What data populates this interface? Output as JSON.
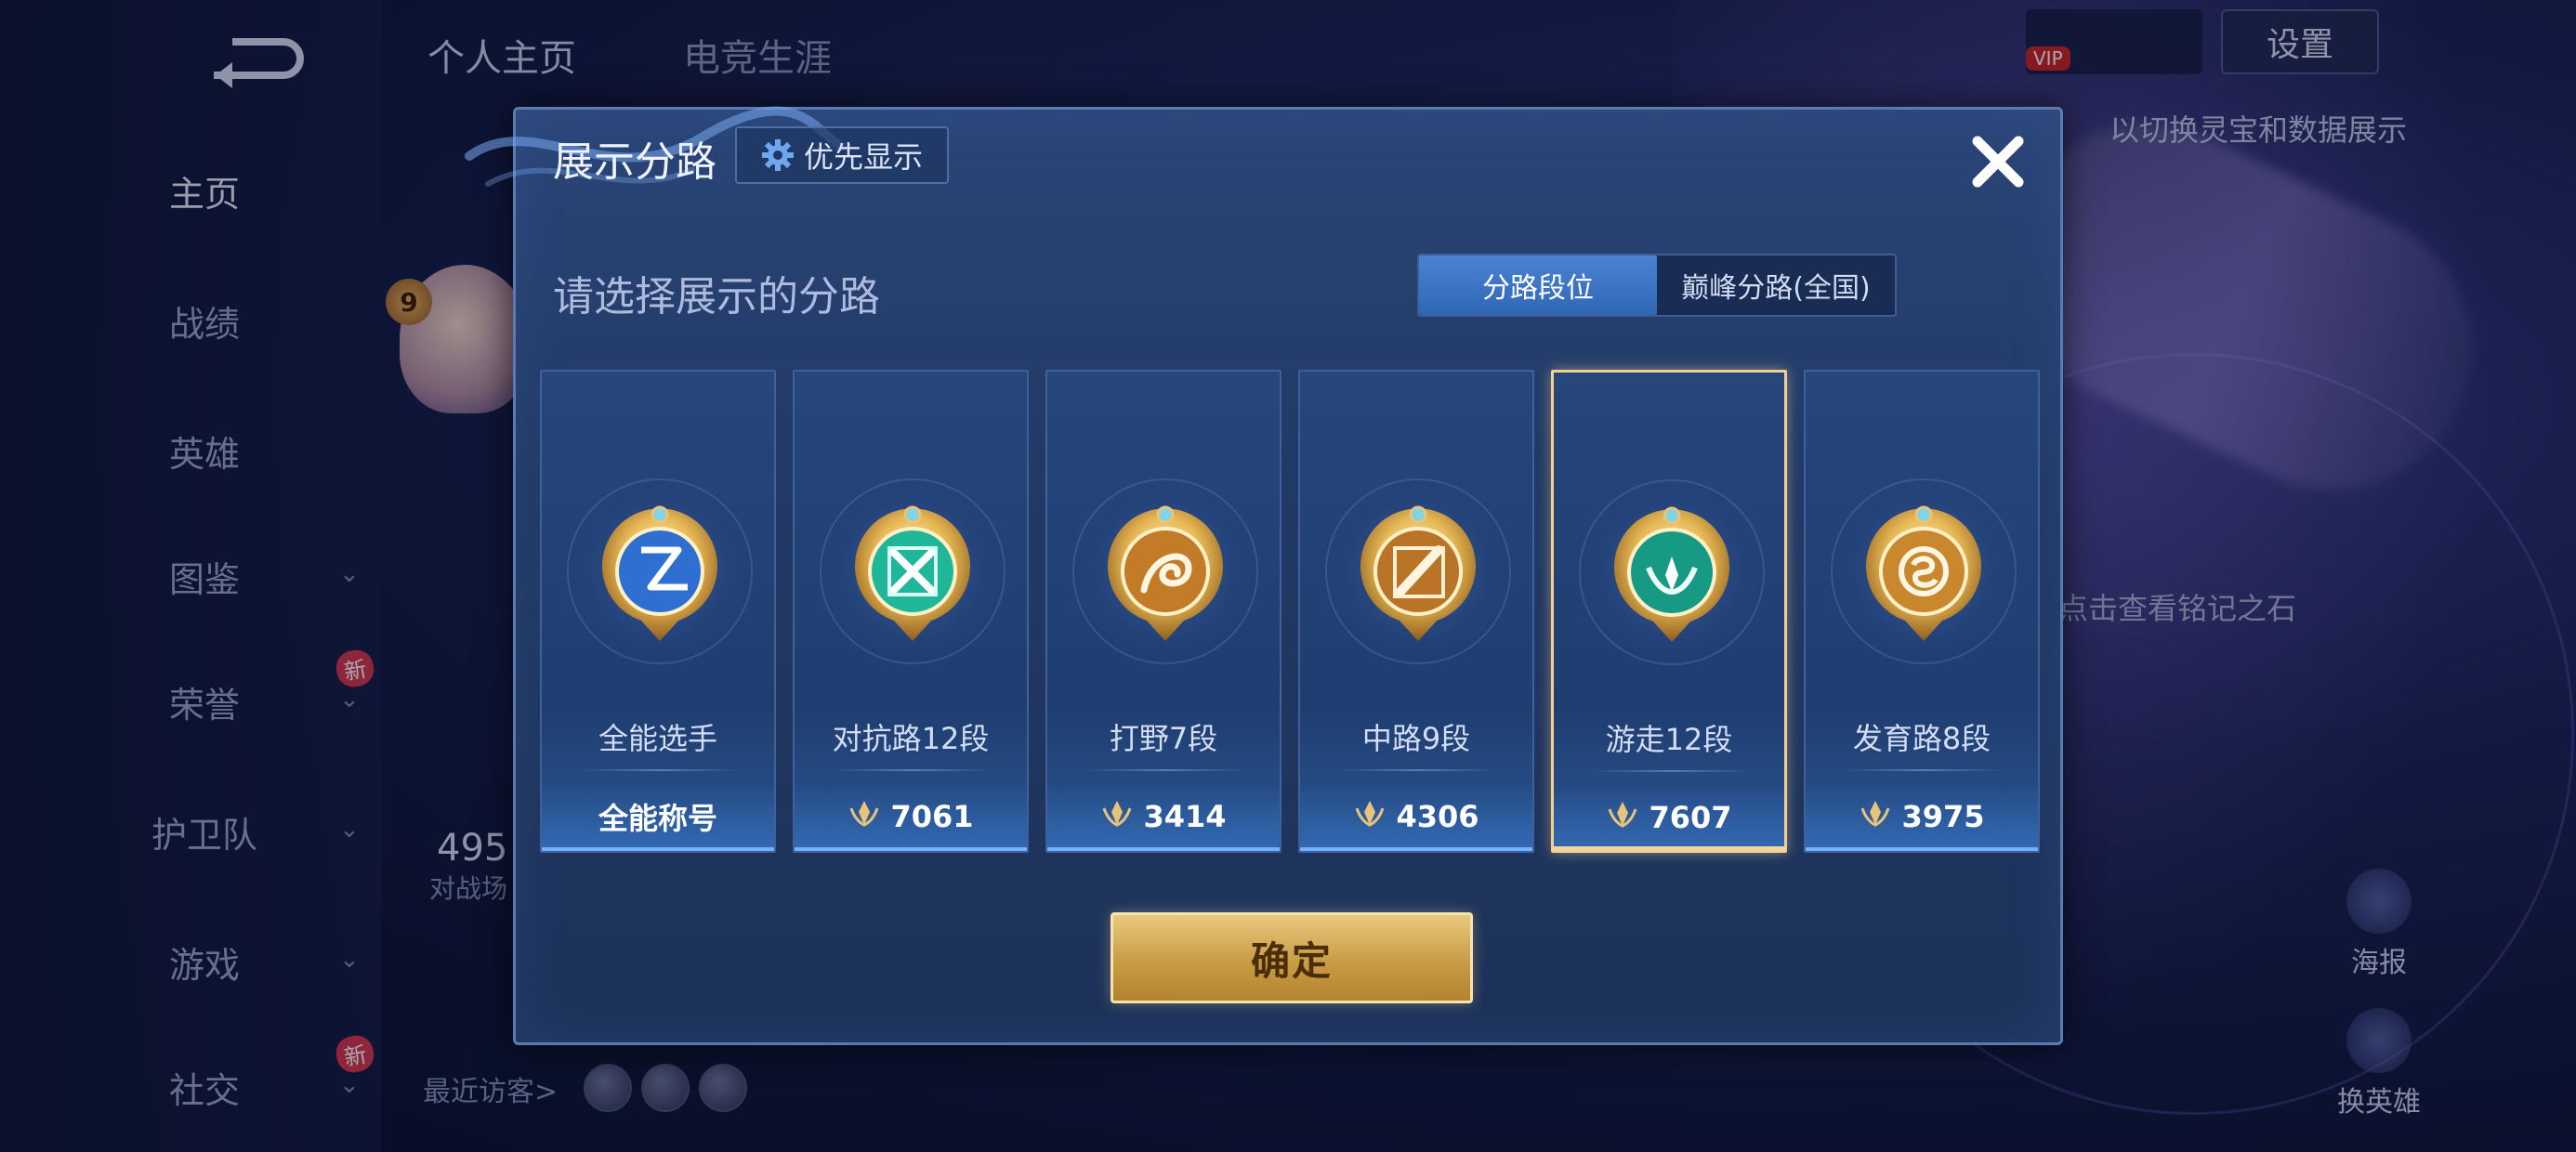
{
  "background": {
    "profile_tabs": [
      "个人主页",
      "电竞生涯"
    ],
    "sidebar": {
      "items": [
        {
          "label": "主页",
          "active": true
        },
        {
          "label": "战绩"
        },
        {
          "label": "英雄"
        },
        {
          "label": "图鉴",
          "chevron": true
        },
        {
          "label": "荣誉",
          "chevron": true,
          "badge": "新"
        },
        {
          "label": "护卫队",
          "chevron": true
        },
        {
          "label": "游戏",
          "chevron": true
        },
        {
          "label": "社交",
          "chevron": true,
          "badge": "新"
        }
      ]
    },
    "level": "9",
    "stat_value": "495",
    "stat_label": "对战场",
    "recent_visitors": "最近访客>",
    "settings_label": "设置",
    "vip_tag": "VIP",
    "hint_top": "以切换灵宝和数据展示",
    "hint_stone": "点击查看铭记之石",
    "tools": [
      {
        "label": "海报"
      },
      {
        "label": "换英雄"
      }
    ]
  },
  "modal": {
    "title": "展示分路",
    "priority_button": "优先显示",
    "subtitle": "请选择展示的分路",
    "tabs": [
      {
        "label": "分路段位",
        "active": true
      },
      {
        "label": "巅峰分路(全国)",
        "active": false
      }
    ],
    "cards": [
      {
        "name": "全能选手",
        "value": "全能称号",
        "emblem": "all-round-emblem",
        "selected": false,
        "points": false
      },
      {
        "name": "对抗路12段",
        "value": "7061",
        "emblem": "clash-lane-emblem",
        "selected": false,
        "points": true
      },
      {
        "name": "打野7段",
        "value": "3414",
        "emblem": "jungle-emblem",
        "selected": false,
        "points": true
      },
      {
        "name": "中路9段",
        "value": "4306",
        "emblem": "mid-lane-emblem",
        "selected": false,
        "points": true
      },
      {
        "name": "游走12段",
        "value": "7607",
        "emblem": "roam-emblem",
        "selected": true,
        "points": true
      },
      {
        "name": "发育路8段",
        "value": "3975",
        "emblem": "farm-lane-emblem",
        "selected": false,
        "points": true
      }
    ],
    "confirm_button": "确定"
  },
  "colors": {
    "modal_bg": "#213965",
    "active_tab": "#3f75c5",
    "selected_border": "#f2cf92",
    "confirm_gold": "#c99c46"
  }
}
